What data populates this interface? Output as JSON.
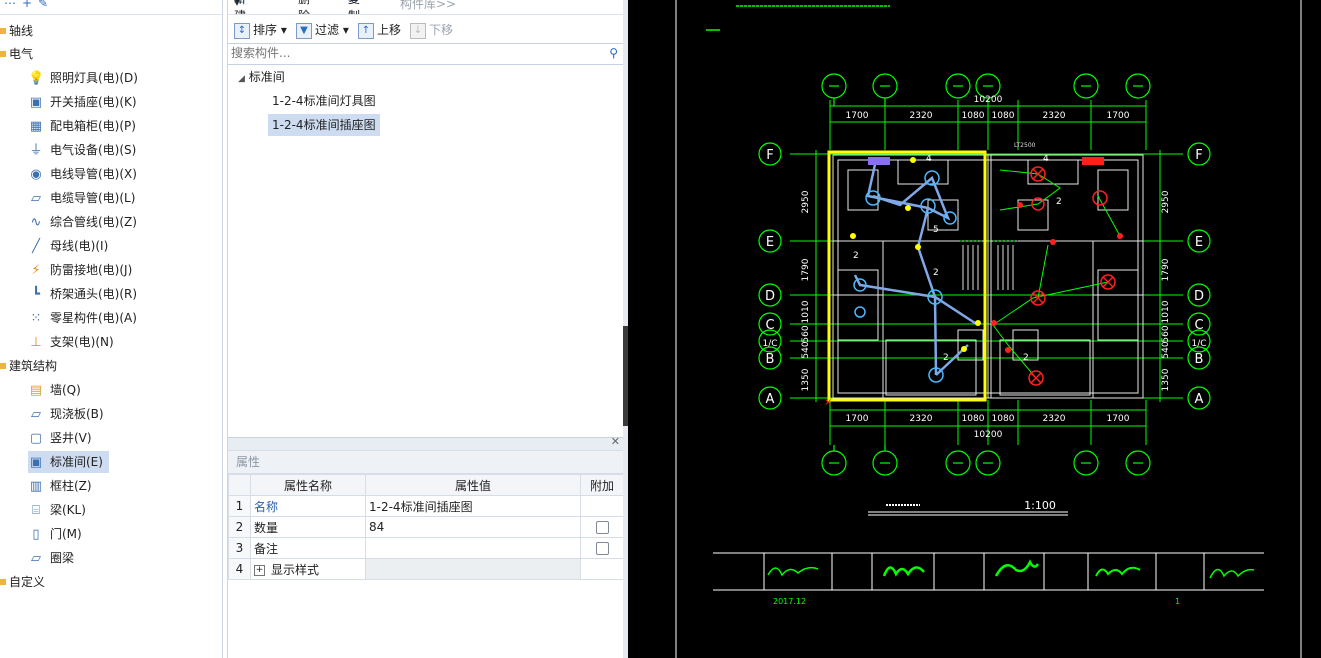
{
  "left_tree": {
    "top_items": [
      {
        "label": "轴线",
        "type": "category"
      },
      {
        "label": "电气",
        "type": "category"
      }
    ],
    "electrical": [
      {
        "label": "照明灯具(电)(D)",
        "icon": "light-bulb-icon"
      },
      {
        "label": "开关插座(电)(K)",
        "icon": "switch-socket-icon"
      },
      {
        "label": "配电箱柜(电)(P)",
        "icon": "distribution-box-icon"
      },
      {
        "label": "电气设备(电)(S)",
        "icon": "plug-icon"
      },
      {
        "label": "电线导管(电)(X)",
        "icon": "wire-conduit-icon"
      },
      {
        "label": "电缆导管(电)(L)",
        "icon": "cable-conduit-icon"
      },
      {
        "label": "综合管线(电)(Z)",
        "icon": "pipeline-icon"
      },
      {
        "label": "母线(电)(I)",
        "icon": "busbar-icon"
      },
      {
        "label": "防雷接地(电)(J)",
        "icon": "lightning-icon"
      },
      {
        "label": "桥架通头(电)(R)",
        "icon": "tray-joint-icon"
      },
      {
        "label": "零星构件(电)(A)",
        "icon": "grid-icon"
      },
      {
        "label": "支架(电)(N)",
        "icon": "bracket-icon"
      }
    ],
    "structure_label": "建筑结构",
    "structure": [
      {
        "label": "墙(Q)",
        "icon": "wall-icon"
      },
      {
        "label": "现浇板(B)",
        "icon": "slab-icon"
      },
      {
        "label": "竖井(V)",
        "icon": "shaft-icon"
      },
      {
        "label": "标准间(E)",
        "icon": "standard-room-icon",
        "selected": true
      },
      {
        "label": "框柱(Z)",
        "icon": "column-icon"
      },
      {
        "label": "梁(KL)",
        "icon": "beam-icon"
      },
      {
        "label": "门(M)",
        "icon": "door-icon"
      },
      {
        "label": "圈梁",
        "icon": "ring-beam-icon"
      }
    ],
    "custom_label": "自定义"
  },
  "toolbar": {
    "new": "新建",
    "delete": "删除",
    "copy": "复制",
    "library": "构件库>>",
    "sort": "排序",
    "filter": "过滤",
    "move_up": "上移",
    "move_down": "下移"
  },
  "search": {
    "placeholder": "搜索构件..."
  },
  "component_tree": {
    "group": "标准间",
    "items": [
      {
        "label": "1-2-4标准间灯具图",
        "selected": false
      },
      {
        "label": "1-2-4标准间插座图",
        "selected": true
      }
    ]
  },
  "properties": {
    "title": "属性",
    "headers": [
      "属性名称",
      "属性值",
      "附加"
    ],
    "rows": [
      {
        "num": "1",
        "name": "名称",
        "value": "1-2-4标准间插座图",
        "checkbox": false
      },
      {
        "num": "2",
        "name": "数量",
        "value": "84",
        "checkbox": true
      },
      {
        "num": "3",
        "name": "备注",
        "value": "",
        "checkbox": true
      },
      {
        "num": "4",
        "name": "显示样式",
        "value": "",
        "checkbox": false
      }
    ]
  },
  "cad": {
    "grid_rows": [
      "F",
      "E",
      "D",
      "C",
      "B",
      "A"
    ],
    "left_row_extra": [
      "1/C"
    ],
    "top_dims": [
      "1700",
      "2320",
      "1080",
      "1080",
      "2320",
      "1700"
    ],
    "top_total": "10200",
    "bottom_dims": [
      "1700",
      "2320",
      "1080",
      "1080",
      "2320",
      "1700"
    ],
    "bottom_total": "10200",
    "side_dims": [
      "2950",
      "1790",
      "1010",
      "560",
      "540",
      "1350"
    ],
    "scale": "1:100",
    "sheet_date": "2017.12",
    "sheet_no": "1",
    "note_small": "LT2500",
    "colors": {
      "grid": "#00ff00",
      "frame": "#ffff00",
      "route": "#7fa8e8",
      "red": "#ff2020",
      "white": "#ffffff"
    }
  }
}
